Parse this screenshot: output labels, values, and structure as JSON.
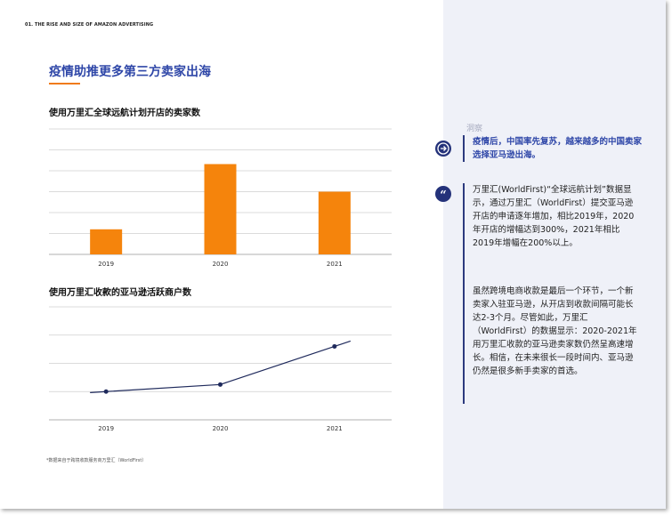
{
  "header": {
    "section_label": "01. THE RISE AND SIZE OF AMAZON ADVERTISING",
    "title": "疫情助推更多第三方卖家出海"
  },
  "colors": {
    "bar": "#f5840c",
    "line": "#1f2a5c",
    "accent": "#2f47a8",
    "underline": "#f07b1a"
  },
  "chart_data": [
    {
      "type": "bar",
      "title": "使用万里汇全球远航计划开店的卖家数",
      "categories": [
        "2019",
        "2020",
        "2021"
      ],
      "values": [
        1,
        3.6,
        2.5
      ],
      "ylim": [
        0,
        5
      ],
      "grid": true
    },
    {
      "type": "line",
      "title": "使用万里汇收款的亚马逊活跃商户数",
      "categories": [
        "2019",
        "2020",
        "2021"
      ],
      "values": [
        1,
        1.25,
        2.6
      ],
      "ylim": [
        0,
        4
      ],
      "grid": true
    }
  ],
  "footnote": "*数据来自于跨境收款服务商万里汇（WorldFirst）",
  "side": {
    "insight_label": "洞察",
    "insight_text": "疫情后，中国率先复苏，越来越多的中国卖家选择亚马逊出海。",
    "paragraph1": "万里汇(WorldFirst)“全球远航计划”数据显示，通过万里汇（WorldFirst）提交亚马逊开店的申请逐年增加，相比2019年，2020年开店的增幅达到300%，2021年相比2019年增幅在200%以上。",
    "paragraph2": "虽然跨境电商收款是最后一个环节，一个新卖家入驻亚马逊，从开店到收款间隔可能长达2-3个月。尽管如此，万里汇（WorldFirst）的数据显示：2020-2021年用万里汇收款的亚马逊卖家数仍然呈高速增长。相信，在未来很长一段时间内、亚马逊仍然是很多新手卖家的首选。",
    "arrow_icon": "→",
    "quote_icon": "❝"
  }
}
